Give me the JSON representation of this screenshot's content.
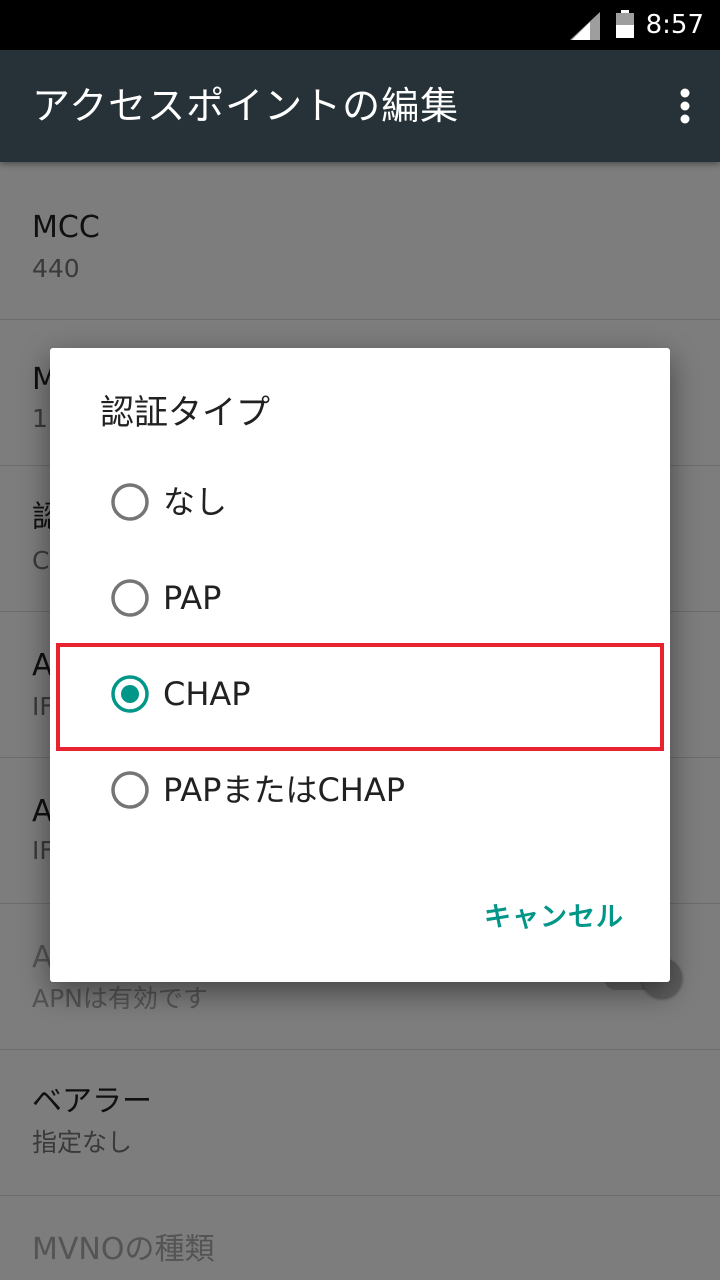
{
  "status_bar": {
    "time": "8:57",
    "icons": [
      "signal-icon",
      "battery-icon"
    ]
  },
  "app_bar": {
    "title": "アクセスポイントの編集",
    "menu_icon": "more-vert-icon"
  },
  "settings": [
    {
      "title": "MCC",
      "value": "440"
    },
    {
      "title": "M",
      "value": "1"
    },
    {
      "title": "認",
      "value": "C"
    },
    {
      "title": "A",
      "value": "IF"
    },
    {
      "title": "A",
      "value": "IF"
    },
    {
      "title": "A",
      "value": "APNは有効です"
    },
    {
      "title": "ベアラー",
      "value": "指定なし"
    },
    {
      "title": "MVNOの種類",
      "value": ""
    }
  ],
  "dialog": {
    "title": "認証タイプ",
    "options": [
      "なし",
      "PAP",
      "CHAP",
      "PAPまたはCHAP"
    ],
    "selected": "CHAP",
    "cancel_label": "キャンセル"
  },
  "colors": {
    "accent": "#009688",
    "app_bar": "#263238",
    "highlight": "#e8222f"
  }
}
